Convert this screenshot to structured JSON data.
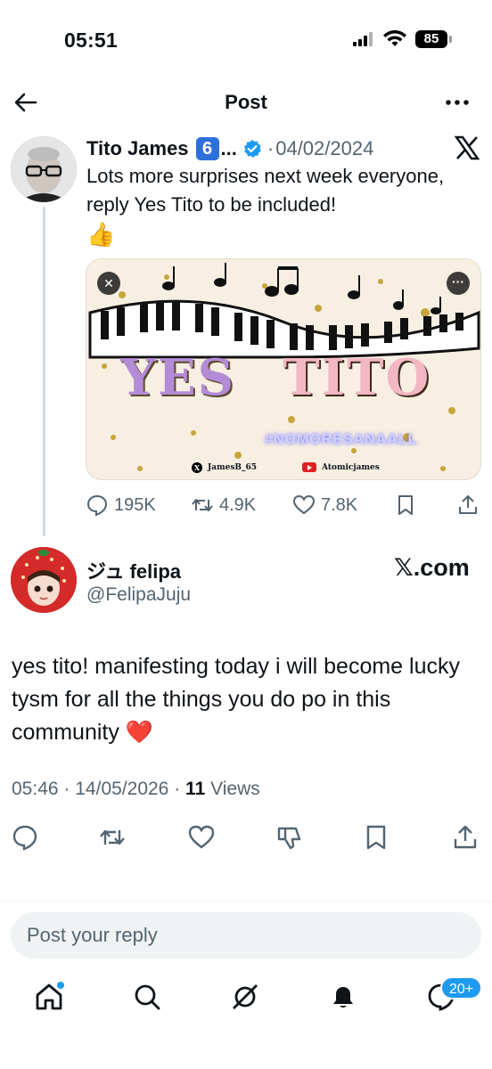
{
  "status_bar": {
    "time": "05:51",
    "battery": "85"
  },
  "nav": {
    "title": "Post"
  },
  "original_tweet": {
    "author_name": "Tito James",
    "badge": "6",
    "truncation": "...",
    "date": "04/02/2024",
    "date_separator": "·",
    "text": "Lots more surprises next week everyone, reply Yes Tito to be included!",
    "emoji": "👍",
    "media": {
      "title_word1": "YES",
      "title_word2": "TITO",
      "hashtag": "#NOMORESANAALL",
      "credit_x": "JamesB_65",
      "credit_youtube": "Atomicjames"
    },
    "stats": {
      "replies": "195K",
      "reposts": "4.9K",
      "likes": "7.8K"
    }
  },
  "reply_tweet": {
    "author_name": "ジュ felipa",
    "handle": "@FelipaJuju",
    "source_label": "𝕏.com",
    "text": "yes tito! manifesting today i will become lucky tysm for all the things you do po in this community ❤️",
    "time": "05:46",
    "date": "14/05/2026",
    "separator": "·",
    "views_count": "11",
    "views_label": "Views"
  },
  "reply_input": {
    "placeholder": "Post your reply"
  },
  "tabbar": {
    "notifications_badge": "20+"
  },
  "colors": {
    "accent": "#1d9bf0",
    "secondary_text": "#536471",
    "text": "#0f1419"
  }
}
